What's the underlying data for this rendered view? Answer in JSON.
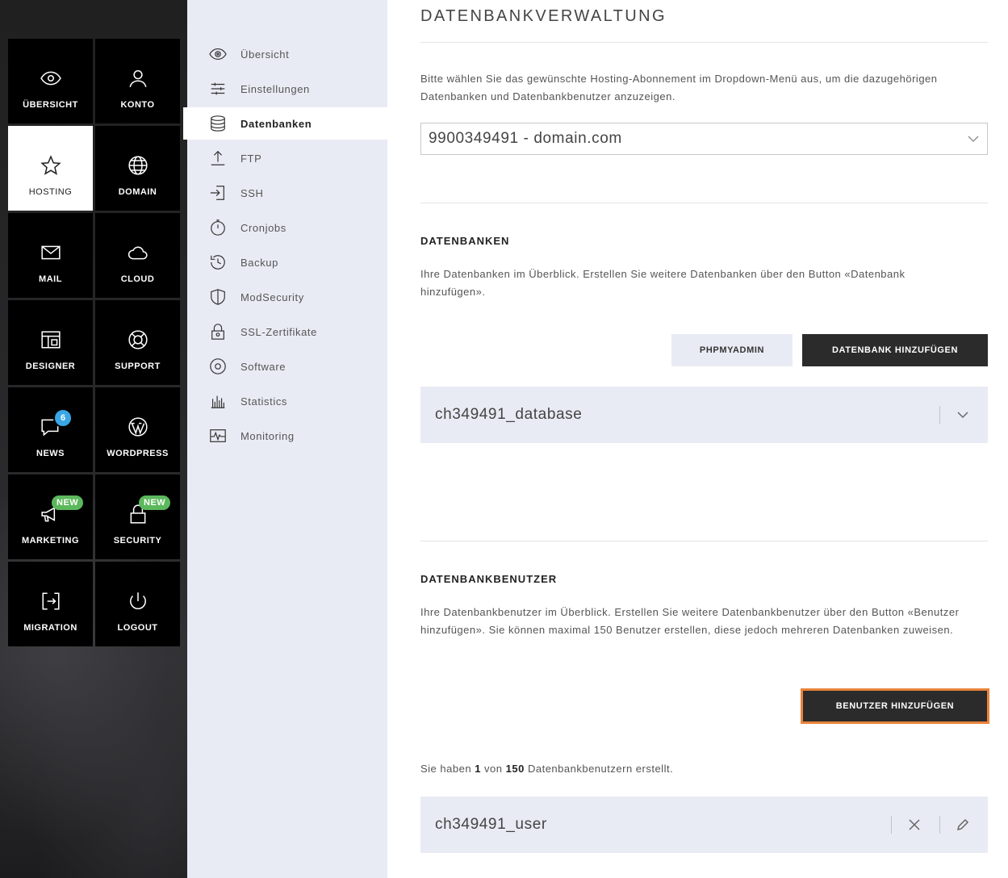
{
  "tiles": [
    {
      "label": "ÜBERSICHT",
      "icon": "eye-icon"
    },
    {
      "label": "KONTO",
      "icon": "user-icon"
    },
    {
      "label": "HOSTING",
      "icon": "star-icon",
      "active": true
    },
    {
      "label": "DOMAIN",
      "icon": "globe-icon"
    },
    {
      "label": "MAIL",
      "icon": "envelope-icon"
    },
    {
      "label": "CLOUD",
      "icon": "cloud-icon"
    },
    {
      "label": "DESIGNER",
      "icon": "layout-icon"
    },
    {
      "label": "SUPPORT",
      "icon": "lifebuoy-icon"
    },
    {
      "label": "NEWS",
      "icon": "chat-icon",
      "badge": "6"
    },
    {
      "label": "WORDPRESS",
      "icon": "wordpress-icon"
    },
    {
      "label": "MARKETING",
      "icon": "megaphone-icon",
      "badge_new": "NEW"
    },
    {
      "label": "SECURITY",
      "icon": "lock-icon",
      "badge_new": "NEW"
    },
    {
      "label": "MIGRATION",
      "icon": "migration-icon"
    },
    {
      "label": "LOGOUT",
      "icon": "power-icon"
    }
  ],
  "submenu": [
    {
      "label": "Übersicht",
      "icon": "eye-icon"
    },
    {
      "label": "Einstellungen",
      "icon": "sliders-icon"
    },
    {
      "label": "Datenbanken",
      "icon": "database-icon",
      "active": true
    },
    {
      "label": "FTP",
      "icon": "upload-icon"
    },
    {
      "label": "SSH",
      "icon": "login-icon"
    },
    {
      "label": "Cronjobs",
      "icon": "stopwatch-icon"
    },
    {
      "label": "Backup",
      "icon": "history-icon"
    },
    {
      "label": "ModSecurity",
      "icon": "shield-icon"
    },
    {
      "label": "SSL-Zertifikate",
      "icon": "certificate-lock-icon"
    },
    {
      "label": "Software",
      "icon": "disc-icon"
    },
    {
      "label": "Statistics",
      "icon": "bar-chart-icon"
    },
    {
      "label": "Monitoring",
      "icon": "pulse-icon"
    }
  ],
  "main": {
    "title": "DATENBANKVERWALTUNG",
    "intro": "Bitte wählen Sie das gewünschte Hosting-Abonnement im Dropdown-Menü aus, um die dazugehörigen Datenbanken und Datenbankbenutzer anzuzeigen.",
    "subscription_select": "9900349491 - domain.com",
    "databases": {
      "title": "DATENBANKEN",
      "description": "Ihre Datenbanken im Überblick. Erstellen Sie weitere Datenbanken über den Button «Datenbank hinzufügen».",
      "phpmyadmin_label": "PHPMYADMIN",
      "add_label": "DATENBANK HINZUFÜGEN",
      "items": [
        "ch349491_database"
      ]
    },
    "users": {
      "title": "DATENBANKBENUTZER",
      "description": "Ihre Datenbankbenutzer im Überblick. Erstellen Sie weitere Datenbankbenutzer über den Button «Benutzer hinzufügen». Sie können maximal 150 Benutzer erstellen, diese jedoch mehreren Datenbanken zuweisen.",
      "add_label": "BENUTZER HINZUFÜGEN",
      "count_prefix": "Sie haben",
      "count_current": "1",
      "count_mid": "von",
      "count_max": "150",
      "count_suffix": "Datenbankbenutzern erstellt.",
      "items": [
        "ch349491_user"
      ]
    }
  },
  "colors": {
    "accent_focus": "#e8833a",
    "badge_blue": "#3aa6e6",
    "badge_green": "#5cb85c",
    "submenu_bg": "#e9ebf4"
  }
}
